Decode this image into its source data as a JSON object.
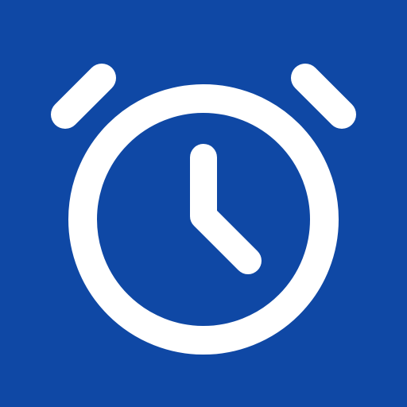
{
  "app_icon": {
    "name": "alarm-clock-icon",
    "background_color": "#0f48a5",
    "glyph_color": "#ffffff"
  }
}
